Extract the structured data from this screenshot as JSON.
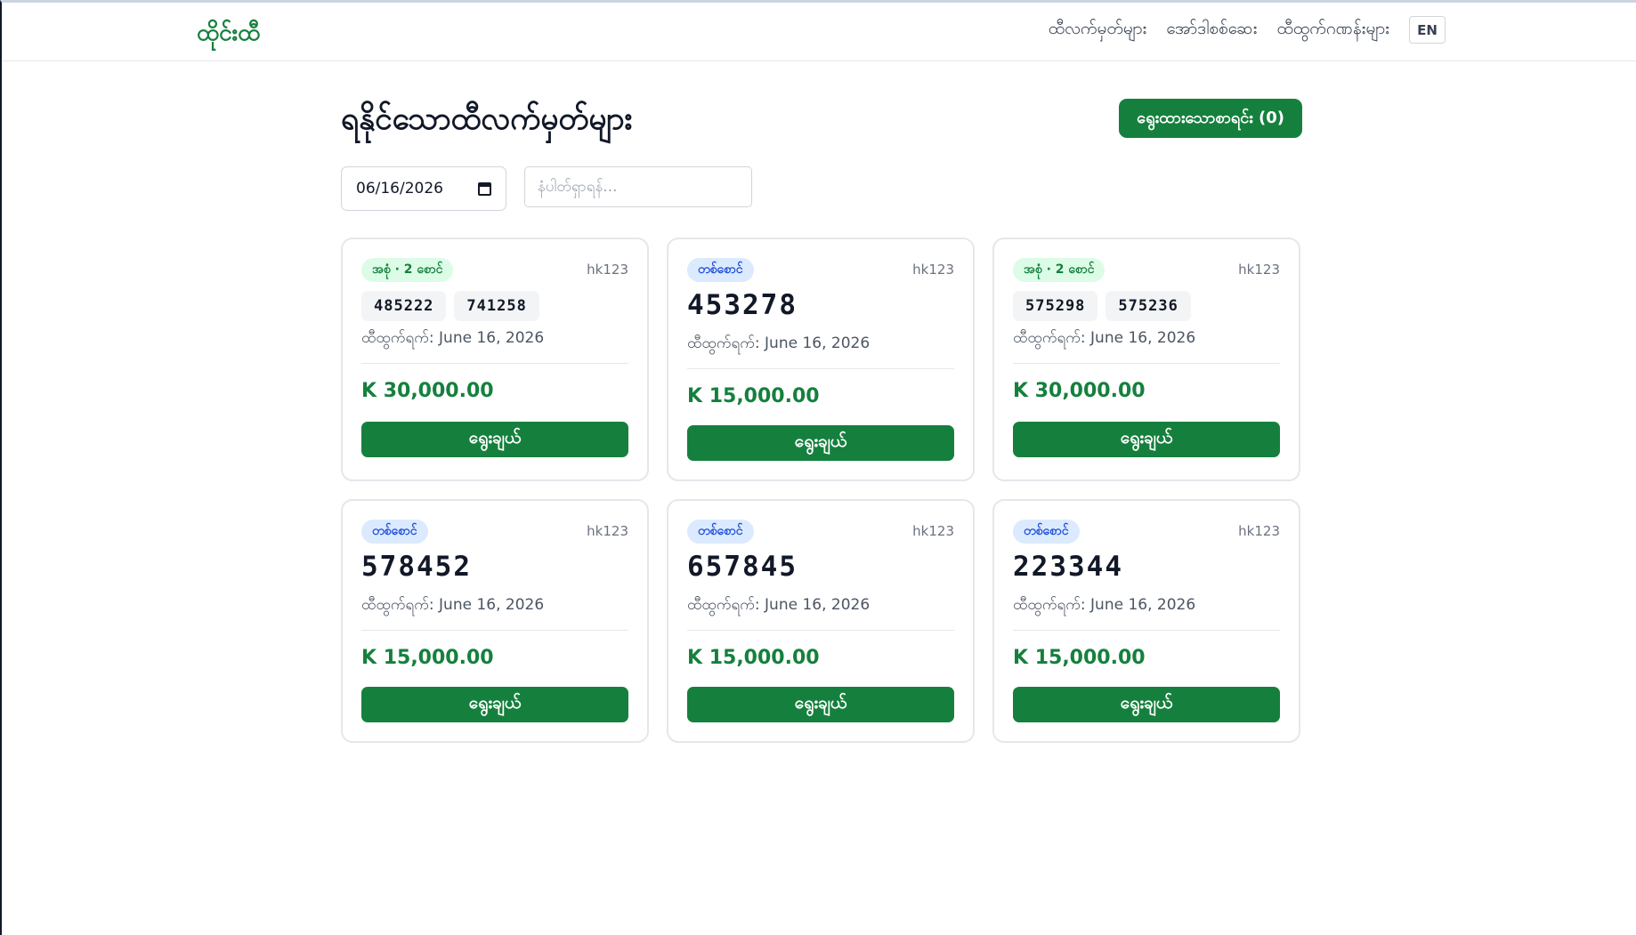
{
  "header": {
    "brand": "ထိုင်းထီ",
    "nav": [
      "ထီလက်မှတ်များ",
      "အော်ဒါစစ်ဆေး",
      "ထီထွက်ဂဏန်းများ"
    ],
    "lang": "EN"
  },
  "main": {
    "title": "ရနိုင်သောထီလက်မှတ်များ",
    "selected_button": "ရွေးထားသောစာရင်း (0)",
    "date_value": "06/16/2026",
    "search_placeholder": "နံပါတ်ရှာရန်..."
  },
  "cards": [
    {
      "type": "set",
      "badge": "အစုံ · 2 စောင်",
      "code": "hk123",
      "numbers": [
        "485222",
        "741258"
      ],
      "date": "ထီထွက်ရက်: June 16, 2026",
      "price": "K 30,000.00",
      "buy": "ရွေးချယ်"
    },
    {
      "type": "single",
      "badge": "တစ်စောင်",
      "code": "hk123",
      "number": "453278",
      "date": "ထီထွက်ရက်: June 16, 2026",
      "price": "K 15,000.00",
      "buy": "ရွေးချယ်"
    },
    {
      "type": "set",
      "badge": "အစုံ · 2 စောင်",
      "code": "hk123",
      "numbers": [
        "575298",
        "575236"
      ],
      "date": "ထီထွက်ရက်: June 16, 2026",
      "price": "K 30,000.00",
      "buy": "ရွေးချယ်"
    },
    {
      "type": "single",
      "badge": "တစ်စောင်",
      "code": "hk123",
      "number": "578452",
      "date": "ထီထွက်ရက်: June 16, 2026",
      "price": "K 15,000.00",
      "buy": "ရွေးချယ်"
    },
    {
      "type": "single",
      "badge": "တစ်စောင်",
      "code": "hk123",
      "number": "657845",
      "date": "ထီထွက်ရက်: June 16, 2026",
      "price": "K 15,000.00",
      "buy": "ရွေးချယ်"
    },
    {
      "type": "single",
      "badge": "တစ်စောင်",
      "code": "hk123",
      "number": "223344",
      "date": "ထီထွက်ရက်: June 16, 2026",
      "price": "K 15,000.00",
      "buy": "ရွေးချယ်"
    }
  ]
}
